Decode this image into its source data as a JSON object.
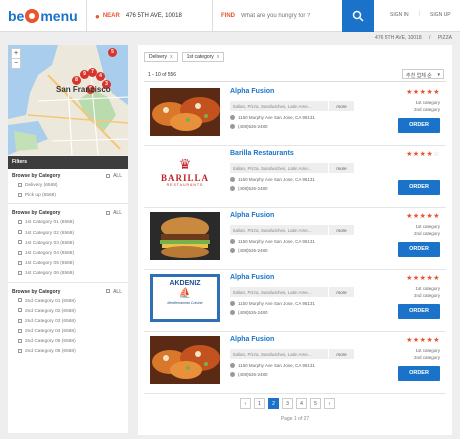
{
  "header": {
    "logo_be": "be",
    "logo_menu": "menu",
    "near_label": "NEAR",
    "near_value": "476 5TH AVE, 10018",
    "find_label": "FIND",
    "find_placeholder": "What are you hungry for ?",
    "sign_in": "SIGN IN",
    "sign_up": "SIGN UP",
    "separator": "|"
  },
  "breadcrumb": {
    "location": "476 5TH AVE, 10018",
    "separator": "/",
    "category": "PIZZA"
  },
  "map": {
    "city_label": "San Francisco",
    "zoom_in": "+",
    "zoom_out": "−",
    "markers": [
      "5",
      "9",
      "8",
      "7",
      "4",
      "6",
      "3"
    ]
  },
  "filters": {
    "title": "Filters",
    "sections": [
      {
        "title": "Browse by Category",
        "all_label": "ALL",
        "items": [
          "Delivery (6568)",
          "Pick up (6568)"
        ]
      },
      {
        "title": "Browse by Category",
        "all_label": "ALL",
        "items": [
          "1st Category 01 (6568)",
          "1st Category 02 (6568)",
          "1st Category 03 (6568)",
          "1st Category 04 (6568)",
          "1st Category 05 (6568)",
          "1st Category 06 (6568)"
        ]
      },
      {
        "title": "Browse by Category",
        "all_label": "ALL",
        "items": [
          "2nd Category 01 (6568)",
          "2nd Category 02 (6568)",
          "2nd Category 03 (6568)",
          "2nd Category 04 (6568)",
          "2nd Category 05 (6568)",
          "2nd Category 06 (6568)"
        ]
      }
    ]
  },
  "results": {
    "active_tags": [
      "Delivery",
      "1st category"
    ],
    "tag_remove": "x",
    "count_text": "1 - 10 of 556",
    "sort_label": "추천 업체 순",
    "cards": [
      {
        "name": "Alpha Fusion",
        "cuisine": "Italian, Pizza, Sandwiches, Latin Ame...",
        "more": "more",
        "address": "1150 Murphy Ave San Jose, CA 95131",
        "phone": "(408)526-2480",
        "rating": 4.5,
        "cat1": "1st category",
        "cat2": "2nd category",
        "order": "ORDER",
        "image": "tacos"
      },
      {
        "name": "Barilla Restaurants",
        "cuisine": "Italian, Pizza, Sandwiches, Latin Ame...",
        "more": "more",
        "address": "1150 Murphy Ave San Jose, CA 95131",
        "phone": "(408)526-2480",
        "rating": 4,
        "cat1": "",
        "cat2": "",
        "order": "ORDER",
        "image": "barilla",
        "logo_text": "BARILLA",
        "logo_sub": "RESTAURANTS"
      },
      {
        "name": "Alpha Fusion",
        "cuisine": "Italian, Pizza, Sandwiches, Latin Ame...",
        "more": "more",
        "address": "1150 Murphy Ave San Jose, CA 95131",
        "phone": "(408)526-2480",
        "rating": 4.5,
        "cat1": "1st category",
        "cat2": "2nd category",
        "order": "ORDER",
        "image": "burger"
      },
      {
        "name": "Alpha Fusion",
        "cuisine": "Italian, Pizza, Sandwiches, Latin Ame...",
        "more": "more",
        "address": "1150 Murphy Ave San Jose, CA 95131",
        "phone": "(408)526-2480",
        "rating": 4.5,
        "cat1": "1st category",
        "cat2": "2nd category",
        "order": "ORDER",
        "image": "akdeniz",
        "logo_text": "AKDENIZ",
        "logo_sub": "Mediterranean Cuisine"
      },
      {
        "name": "Alpha Fusion",
        "cuisine": "Italian, Pizza, Sandwiches, Latin Ame...",
        "more": "more",
        "address": "1150 Murphy Ave San Jose, CA 95131",
        "phone": "(408)526-2480",
        "rating": 4.5,
        "cat1": "1st category",
        "cat2": "2nd category",
        "order": "ORDER",
        "image": "tacos"
      }
    ]
  },
  "pagination": {
    "prev": "‹",
    "next": "›",
    "pages": [
      "1",
      "2",
      "3",
      "4",
      "5"
    ],
    "active_page": "2",
    "info": "Page 1 of 27"
  },
  "colors": {
    "accent": "#1a73c8",
    "brand_orange": "#e8552e",
    "filter_header": "#3d3d3d"
  }
}
